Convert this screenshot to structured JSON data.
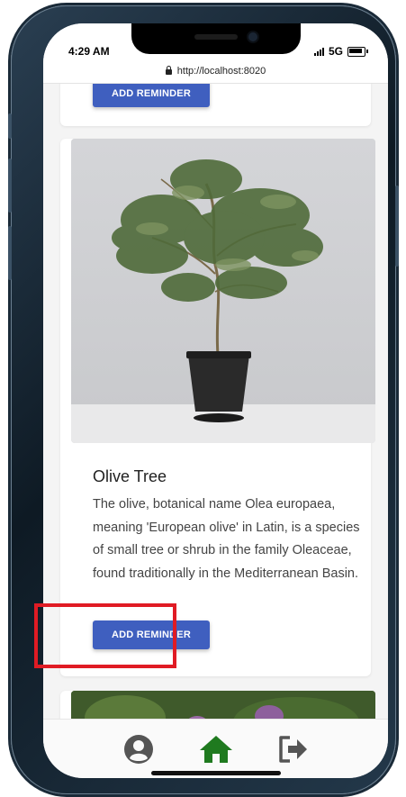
{
  "status_bar": {
    "time": "4:29 AM",
    "network": "5G"
  },
  "browser": {
    "url": "http://localhost:8020"
  },
  "previous_card": {
    "button_label": "ADD REMINDER"
  },
  "plant_card": {
    "title": "Olive Tree",
    "description": "The olive, botanical name Olea europaea, meaning 'European olive' in Latin, is a species of small tree or shrub in the family Oleaceae, found traditionally in the Mediterranean Basin.",
    "button_label": "ADD REMINDER"
  },
  "bottom_nav": {
    "items": [
      {
        "name": "profile",
        "icon": "user-circle-icon"
      },
      {
        "name": "home",
        "icon": "home-icon",
        "active": true
      },
      {
        "name": "logout",
        "icon": "sign-out-icon"
      }
    ]
  },
  "colors": {
    "accent_button": "#3f5fbf",
    "home_active": "#1f7a1f",
    "nav_icon": "#555555",
    "highlight_box": "#e01b24"
  }
}
